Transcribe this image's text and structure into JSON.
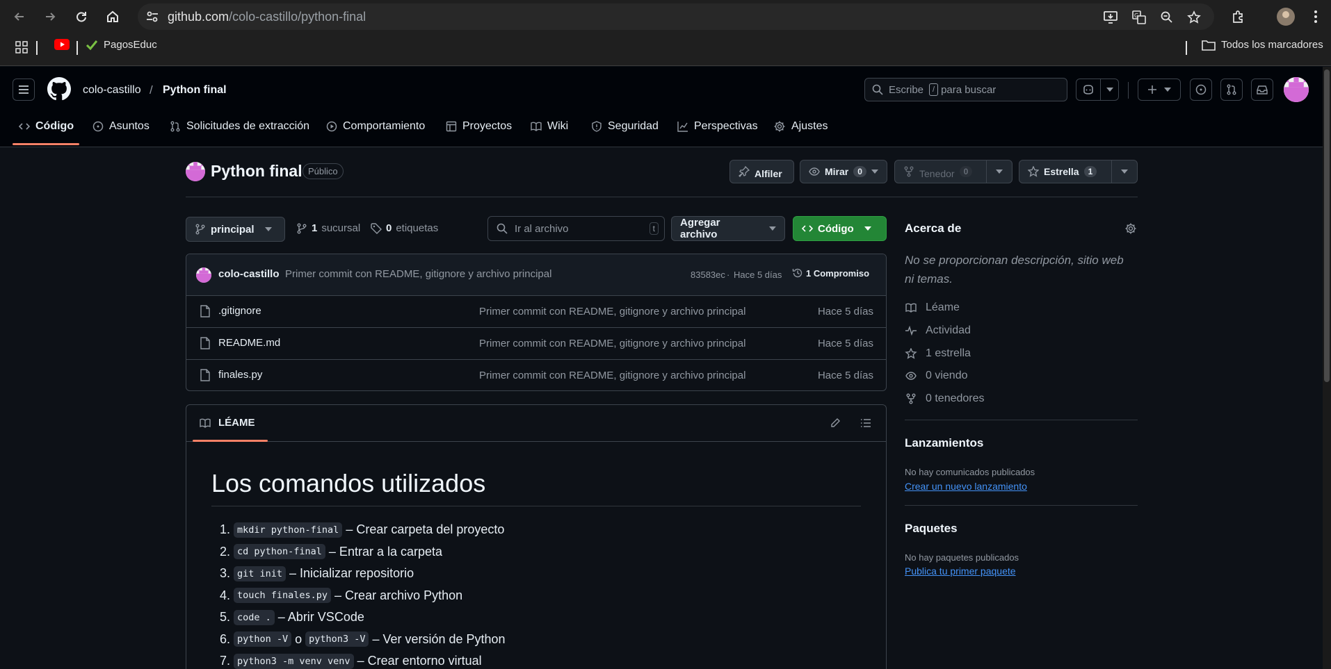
{
  "browser": {
    "url_host": "github.com",
    "url_path": "/colo-castillo/python-final",
    "bookmarks": [
      {
        "label": ""
      },
      {
        "label": "PagosEduc"
      }
    ],
    "all_bookmarks": "Todos los marcadores"
  },
  "repo": {
    "owner": "colo-castillo",
    "separator": "/",
    "name": "Python final",
    "visibility": "Público"
  },
  "search": {
    "placeholder_before": "Escribe",
    "key": "/",
    "placeholder_after": "para buscar"
  },
  "tabs": [
    {
      "label": "Código"
    },
    {
      "label": "Asuntos"
    },
    {
      "label": "Solicitudes de extracción"
    },
    {
      "label": "Comportamiento"
    },
    {
      "label": "Proyectos"
    },
    {
      "label": "Wiki"
    },
    {
      "label": "Seguridad"
    },
    {
      "label": "Perspectivas"
    },
    {
      "label": "Ajustes"
    }
  ],
  "actions": {
    "pin": "Alfiler",
    "watch": "Mirar",
    "watch_count": "0",
    "fork": "Tenedor",
    "fork_count": "0",
    "star": "Estrella",
    "star_count": "1"
  },
  "toolbar": {
    "branch": "principal",
    "branches_count": "1",
    "branches_label": "sucursal",
    "tags_count": "0",
    "tags_label": "etiquetas",
    "goto_file": "Ir al archivo",
    "goto_key": "t",
    "add_file": "Agregar archivo",
    "code": "Código"
  },
  "commit": {
    "author": "colo-castillo",
    "message": "Primer commit con README, gitignore y archivo principal",
    "hash": "83583ec",
    "dot": "·",
    "time": "Hace 5 días",
    "count": "1 Compromiso"
  },
  "files": [
    {
      "name": ".gitignore",
      "message": "Primer commit con README, gitignore y archivo principal",
      "date": "Hace 5 días"
    },
    {
      "name": "README.md",
      "message": "Primer commit con README, gitignore y archivo principal",
      "date": "Hace 5 días"
    },
    {
      "name": "finales.py",
      "message": "Primer commit con README, gitignore y archivo principal",
      "date": "Hace 5 días"
    }
  ],
  "readme": {
    "tab": "LÉAME",
    "heading": "Los comandos utilizados",
    "items": [
      {
        "num": "1.",
        "code": "mkdir python-final",
        "text": "– Crear carpeta del proyecto"
      },
      {
        "num": "2.",
        "code": "cd python-final",
        "text": "– Entrar a la carpeta"
      },
      {
        "num": "3.",
        "code": "git init",
        "text": "– Inicializar repositorio"
      },
      {
        "num": "4.",
        "code": "touch finales.py",
        "text": "– Crear archivo Python"
      },
      {
        "num": "5.",
        "code": "code .",
        "text": "– Abrir VSCode"
      },
      {
        "num": "6.",
        "code": "python -V",
        "mid": "o",
        "code2": "python3 -V",
        "text": "– Ver versión de Python"
      },
      {
        "num": "7.",
        "code": "python3 -m venv venv",
        "text": "– Crear entorno virtual"
      }
    ]
  },
  "about": {
    "title": "Acerca de",
    "description": "No se proporcionan descripción, sitio web ni temas.",
    "items": [
      {
        "icon": "book-icon",
        "label": "Léame"
      },
      {
        "icon": "pulse-icon",
        "label": "Actividad"
      },
      {
        "icon": "star-icon",
        "label": "1 estrella"
      },
      {
        "icon": "eye-icon",
        "label": "0 viendo"
      },
      {
        "icon": "fork-icon",
        "label": "0 tenedores"
      }
    ]
  },
  "releases": {
    "title": "Lanzamientos",
    "empty": "No hay comunicados publicados",
    "link": "Crear un nuevo lanzamiento"
  },
  "packages": {
    "title": "Paquetes",
    "empty": "No hay paquetes publicados",
    "link": "Publica tu primer paquete"
  },
  "colors": {
    "accent_green": "#238636",
    "link_blue": "#4493f8",
    "tab_underline": "#f78166"
  }
}
